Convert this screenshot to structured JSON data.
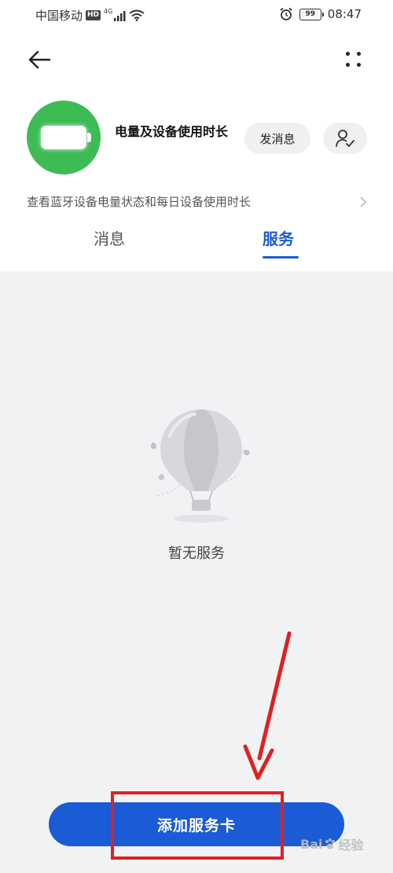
{
  "status_bar": {
    "carrier": "中国移动",
    "hd_badge": "HD",
    "network": "4G",
    "battery_level": "99",
    "time": "08:47"
  },
  "header": {
    "back_icon": "back-arrow-icon",
    "more_icon": "more-dots-icon"
  },
  "service": {
    "name": "电量及设备使用时长",
    "avatar_icon": "battery-icon",
    "avatar_color": "#3dbb54",
    "message_button_label": "发消息",
    "follow_icon": "user-follow-icon",
    "description": "查看蓝牙设备电量状态和每日设备使用时长"
  },
  "tabs": [
    {
      "label": "消息",
      "active": false
    },
    {
      "label": "服务",
      "active": true
    }
  ],
  "empty_state": {
    "illustration": "hot-air-balloon-icon",
    "text": "暂无服务"
  },
  "footer": {
    "add_button_label": "添加服务卡"
  },
  "annotation": {
    "highlight_color": "#e02020"
  },
  "watermark": {
    "text": "Bai",
    "suffix": "经验"
  },
  "colors": {
    "accent": "#1a5bd6",
    "background": "#f1f2f4"
  }
}
